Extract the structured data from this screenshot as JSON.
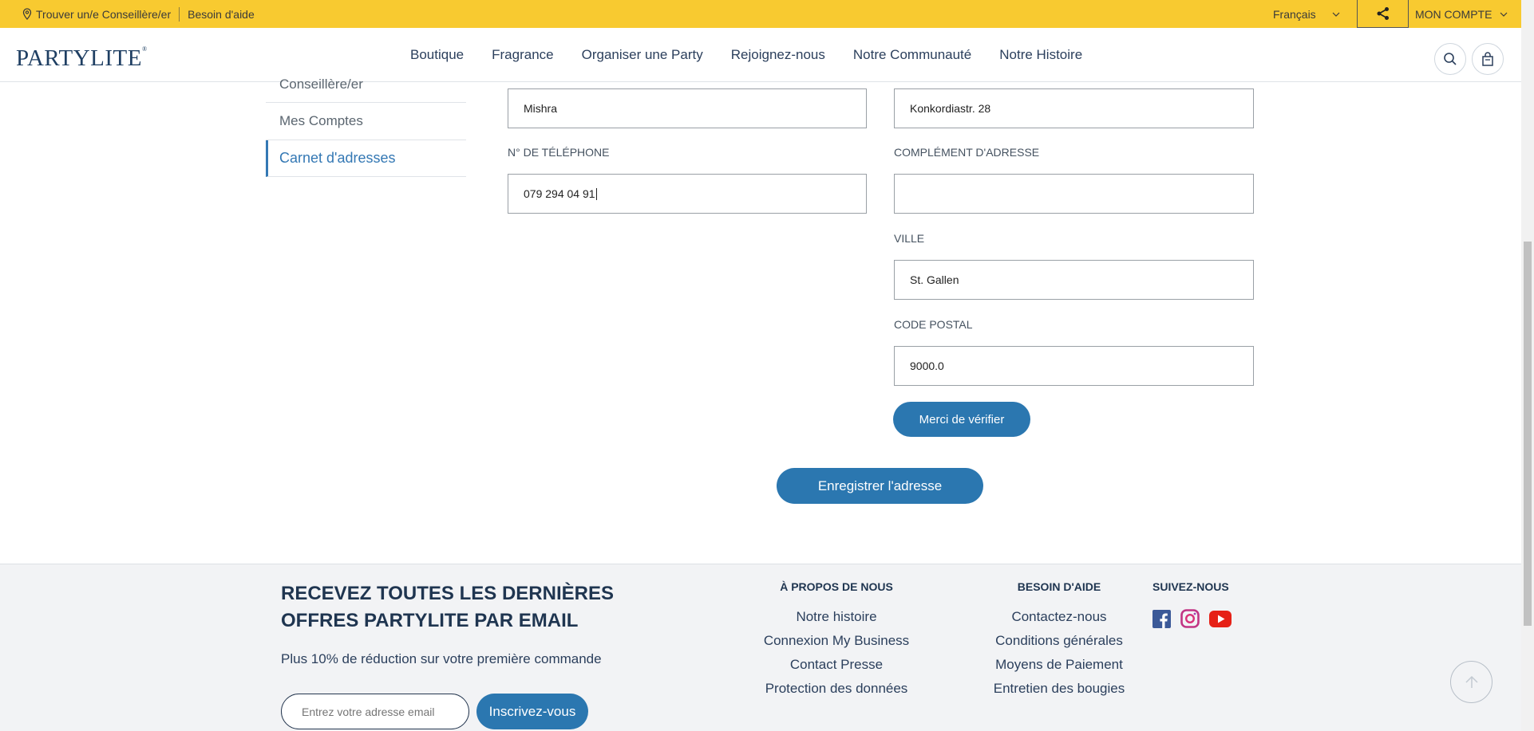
{
  "topbar": {
    "find_consultant": "Trouver un/e Conseillère/er",
    "help": "Besoin d'aide",
    "language": "Français",
    "account": "MON COMPTE"
  },
  "nav": {
    "logo": "PARTYLITE",
    "items": [
      "Boutique",
      "Fragrance",
      "Organiser une Party",
      "Rejoignez-nous",
      "Notre Communauté",
      "Notre Histoire"
    ]
  },
  "sidebar": {
    "items": [
      {
        "label": "Conseillère/er"
      },
      {
        "label": "Mes Comptes"
      },
      {
        "label": "Carnet d'adresses"
      }
    ]
  },
  "form": {
    "last_name_value": "Mishra",
    "address_value": "Konkordiastr. 28",
    "phone_label": "N° DE TÉLÉPHONE",
    "phone_value": "079 294 04 91",
    "address2_label": "COMPLÉMENT D'ADRESSE",
    "address2_value": "",
    "city_label": "VILLE",
    "city_value": "St. Gallen",
    "postal_label": "CODE POSTAL",
    "postal_value": "9000.0",
    "verify_button": "Merci de vérifier",
    "save_button": "Enregistrer l'adresse"
  },
  "footer": {
    "headline": "RECEVEZ TOUTES LES DERNIÈRES OFFRES PARTYLITE PAR EMAIL",
    "subtext": "Plus 10% de réduction sur votre première commande",
    "email_placeholder": "Entrez votre adresse email",
    "subscribe_button": "Inscrivez-vous",
    "about": {
      "title": "À PROPOS DE NOUS",
      "links": [
        "Notre histoire",
        "Connexion My Business",
        "Contact Presse",
        "Protection des données"
      ]
    },
    "help": {
      "title": "BESOIN D'AIDE",
      "links": [
        "Contactez-nous",
        "Conditions générales",
        "Moyens de Paiement",
        "Entretien des bougies"
      ]
    },
    "social": {
      "title": "SUIVEZ-NOUS",
      "icons": [
        "facebook-icon",
        "instagram-icon",
        "youtube-icon"
      ]
    }
  },
  "colors": {
    "topbar": "#f8ca30",
    "accent": "#2b77b0",
    "navy": "#1f3550",
    "footer_bg": "#f2f3f5"
  }
}
